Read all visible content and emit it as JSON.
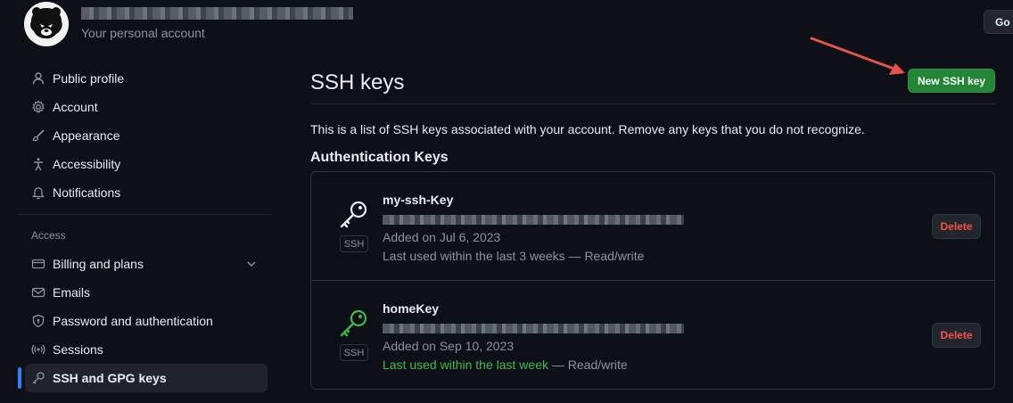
{
  "header": {
    "account_subtitle": "Your personal account",
    "go_button": "Go t"
  },
  "sidebar": {
    "items": [
      {
        "label": "Public profile",
        "icon": "person-icon"
      },
      {
        "label": "Account",
        "icon": "gear-icon"
      },
      {
        "label": "Appearance",
        "icon": "paintbrush-icon"
      },
      {
        "label": "Accessibility",
        "icon": "accessibility-icon"
      },
      {
        "label": "Notifications",
        "icon": "bell-icon"
      }
    ],
    "access_heading": "Access",
    "access_items": [
      {
        "label": "Billing and plans",
        "icon": "credit-card-icon"
      },
      {
        "label": "Emails",
        "icon": "mail-icon"
      },
      {
        "label": "Password and authentication",
        "icon": "shield-icon"
      },
      {
        "label": "Sessions",
        "icon": "broadcast-icon"
      },
      {
        "label": "SSH and GPG keys",
        "icon": "key-icon",
        "active": true
      }
    ]
  },
  "main": {
    "title": "SSH keys",
    "new_button": "New SSH key",
    "description": "This is a list of SSH keys associated with your account. Remove any keys that you do not recognize.",
    "section_title": "Authentication Keys",
    "keys": [
      {
        "name": "my-ssh-Key",
        "badge": "SSH",
        "added": "Added on Jul 6, 2023",
        "last_used": "Last used within the last 3 weeks",
        "access": " — Read/write",
        "delete_label": "Delete",
        "icon_color": "#e6edf3"
      },
      {
        "name": "homeKey",
        "badge": "SSH",
        "added": "Added on Sep 10, 2023",
        "last_used": "Last used within the last week",
        "access": " — Read/write",
        "delete_label": "Delete",
        "icon_color": "#3fb950"
      }
    ]
  },
  "colors": {
    "background": "#0d1117",
    "primary_button": "#238636",
    "danger_text": "#f85149",
    "active_indicator": "#2f81f7",
    "annotation_arrow": "#e5534b"
  }
}
